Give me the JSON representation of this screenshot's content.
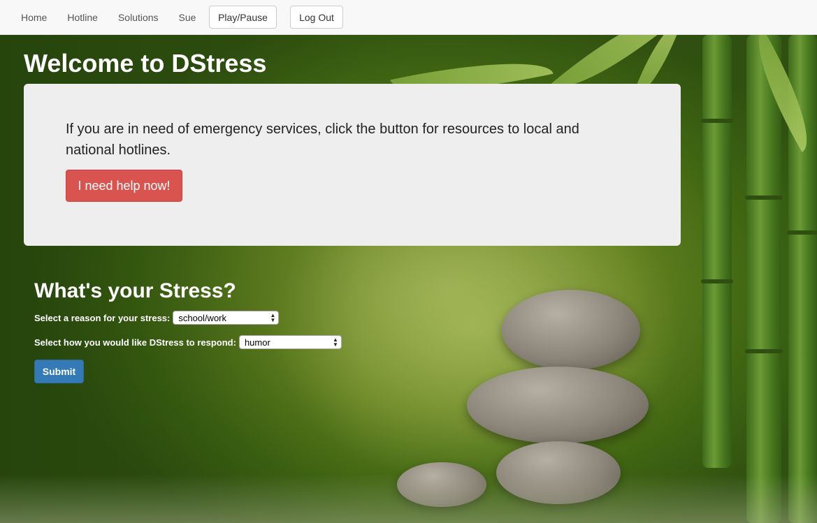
{
  "nav": {
    "links": [
      "Home",
      "Hotline",
      "Solutions",
      "Sue"
    ],
    "play_pause": "Play/Pause",
    "logout": "Log Out"
  },
  "page_title": "Welcome to DStress",
  "emergency": {
    "message": "If you are in need of emergency services, click the button for resources to local and national hotlines.",
    "button": "I need help now!"
  },
  "stress_form": {
    "heading": "What's your Stress?",
    "reason_label": "Select a reason for your stress:",
    "reason_value": "school/work",
    "respond_label": "Select how you would like DStress to respond:",
    "respond_value": "humor",
    "submit": "Submit"
  },
  "colors": {
    "danger": "#d9534f",
    "primary": "#337ab7",
    "panel": "#eeeeee"
  },
  "icons": {
    "select_arrow": "updown-arrows-icon"
  }
}
